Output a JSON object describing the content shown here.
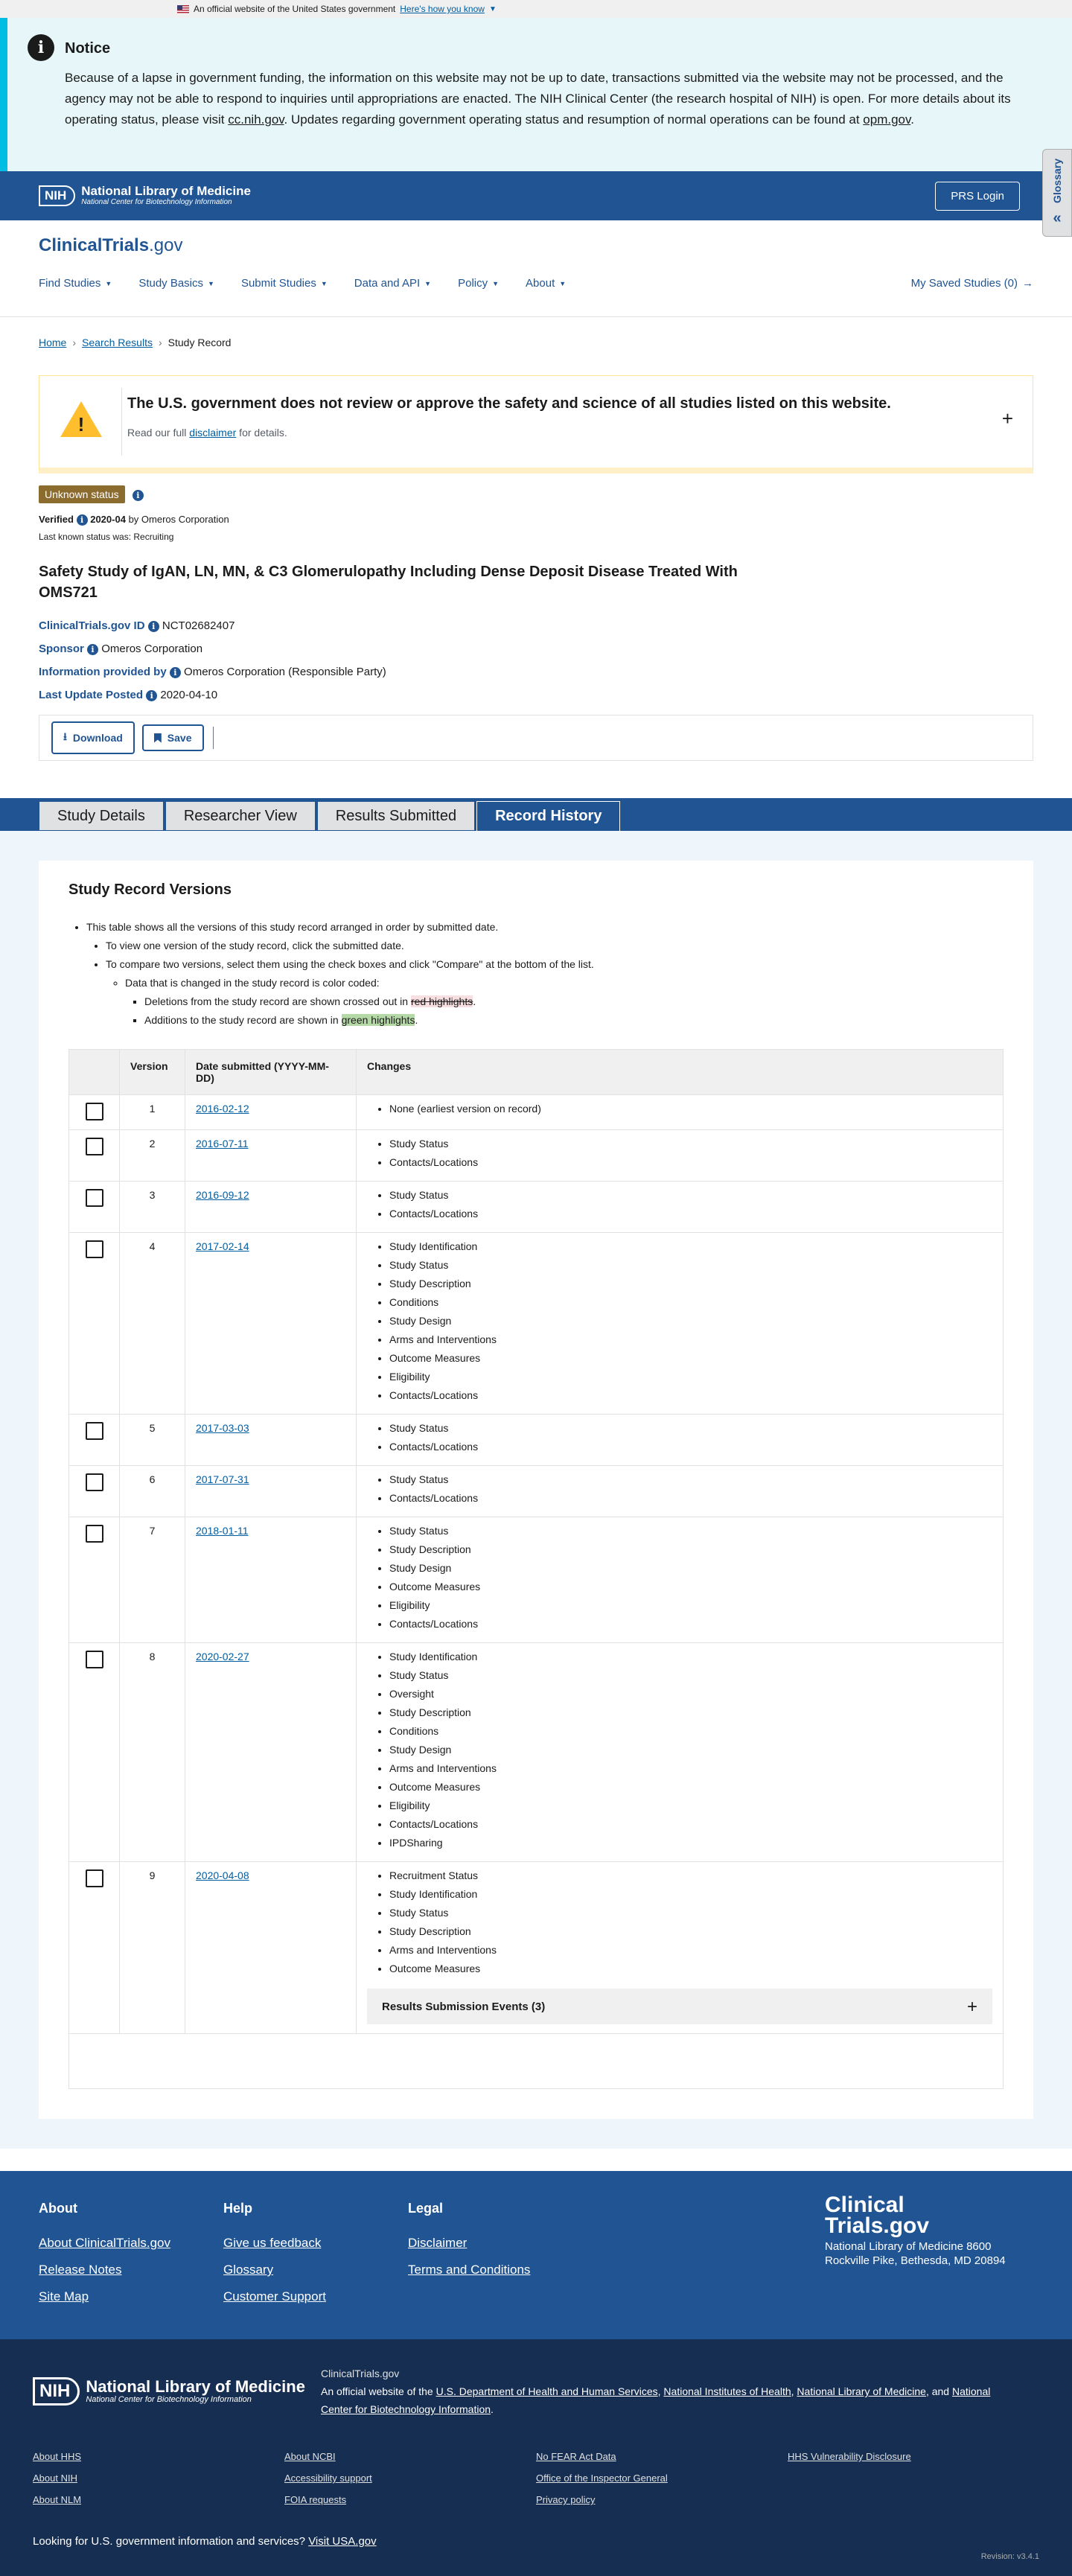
{
  "gov_banner": {
    "text": "An official website of the United States government",
    "link": "Here's how you know"
  },
  "notice": {
    "title": "Notice",
    "body_before_link1": "Because of a lapse in government funding, the information on this website may not be up to date, transactions submitted via the website may not be processed, and the agency may not be able to respond to inquiries until appropriations are enacted. The NIH Clinical Center (the research hospital of NIH) is open. For more details about its operating status, please visit ",
    "link1": "cc.nih.gov",
    "body_between": ". Updates regarding government operating status and resumption of normal operations can be found at ",
    "link2": "opm.gov",
    "body_end": "."
  },
  "nih_header": {
    "logo": "NIH",
    "line1": "National Library of Medicine",
    "line2": "National Center for Biotechnology Information",
    "prs_login": "PRS Login",
    "glossary": "Glossary"
  },
  "site": {
    "logo_main": "ClinicalTrials",
    "logo_suffix": ".gov",
    "nav": [
      "Find Studies",
      "Study Basics",
      "Submit Studies",
      "Data and API",
      "Policy",
      "About"
    ],
    "saved": "My Saved Studies (0)"
  },
  "breadcrumb": [
    "Home",
    "Search Results",
    "Study Record"
  ],
  "disclaimer": {
    "title": "The U.S. government does not review or approve the safety and science of all studies listed on this website.",
    "pre": "Read our full ",
    "link": "disclaimer",
    "post": " for details."
  },
  "status": {
    "badge": "Unknown status",
    "verified_label": "Verified",
    "verified_date": "2020-04",
    "verified_by": "by Omeros Corporation",
    "last_known": "Last known status was: Recruiting"
  },
  "study": {
    "title": "Safety Study of IgAN, LN, MN, & C3 Glomerulopathy Including Dense Deposit Disease Treated With OMS721",
    "id_label": "ClinicalTrials.gov ID",
    "id_value": "NCT02682407",
    "sponsor_label": "Sponsor",
    "sponsor_value": "Omeros Corporation",
    "info_label": "Information provided by",
    "info_value": "Omeros Corporation (Responsible Party)",
    "update_label": "Last Update Posted",
    "update_value": "2020-04-10"
  },
  "actions": {
    "download": "Download",
    "save": "Save"
  },
  "tabs": [
    "Study Details",
    "Researcher View",
    "Results Submitted",
    "Record History"
  ],
  "record": {
    "title": "Study Record Versions",
    "intro1": "This table shows all the versions of this study record arranged in order by submitted date.",
    "intro2": "To view one version of the study record, click the submitted date.",
    "intro3": "To compare two versions, select them using the check boxes and click \"Compare\" at the bottom of the list.",
    "intro4": "Data that is changed in the study record is color coded:",
    "del_pre": "Deletions from the study record are shown crossed out in ",
    "del_hl": "red highlights",
    "add_pre": "Additions to the study record are shown in ",
    "add_hl": "green highlights",
    "headers": {
      "version": "Version",
      "date": "Date submitted (YYYY-MM-DD)",
      "changes": "Changes"
    },
    "events": "Results Submission Events (3)",
    "rows": [
      {
        "version": "1",
        "date": "2016-02-12",
        "changes": [
          "None (earliest version on record)"
        ]
      },
      {
        "version": "2",
        "date": "2016-07-11",
        "changes": [
          "Study Status",
          "Contacts/Locations"
        ]
      },
      {
        "version": "3",
        "date": "2016-09-12",
        "changes": [
          "Study Status",
          "Contacts/Locations"
        ]
      },
      {
        "version": "4",
        "date": "2017-02-14",
        "changes": [
          "Study Identification",
          "Study Status",
          "Study Description",
          "Conditions",
          "Study Design",
          "Arms and Interventions",
          "Outcome Measures",
          "Eligibility",
          "Contacts/Locations"
        ]
      },
      {
        "version": "5",
        "date": "2017-03-03",
        "changes": [
          "Study Status",
          "Contacts/Locations"
        ]
      },
      {
        "version": "6",
        "date": "2017-07-31",
        "changes": [
          "Study Status",
          "Contacts/Locations"
        ]
      },
      {
        "version": "7",
        "date": "2018-01-11",
        "changes": [
          "Study Status",
          "Study Description",
          "Study Design",
          "Outcome Measures",
          "Eligibility",
          "Contacts/Locations"
        ]
      },
      {
        "version": "8",
        "date": "2020-02-27",
        "changes": [
          "Study Identification",
          "Study Status",
          "Oversight",
          "Study Description",
          "Conditions",
          "Study Design",
          "Arms and Interventions",
          "Outcome Measures",
          "Eligibility",
          "Contacts/Locations",
          "IPDSharing"
        ]
      },
      {
        "version": "9",
        "date": "2020-04-08",
        "changes": [
          "Recruitment Status",
          "Study Identification",
          "Study Status",
          "Study Description",
          "Arms and Interventions",
          "Outcome Measures"
        ]
      }
    ]
  },
  "footer": {
    "cols": [
      {
        "title": "About",
        "links": [
          "About ClinicalTrials.gov",
          "Release Notes",
          "Site Map"
        ]
      },
      {
        "title": "Help",
        "links": [
          "Give us feedback",
          "Glossary",
          "Customer Support"
        ]
      },
      {
        "title": "Legal",
        "links": [
          "Disclaimer",
          "Terms and Conditions"
        ]
      }
    ],
    "brand_line1": "Clinical",
    "brand_line2": "Trials.gov",
    "address": "National Library of Medicine 8600 Rockville Pike, Bethesda, MD 20894"
  },
  "footer_bottom": {
    "logo": "NIH",
    "line1": "National Library of Medicine",
    "line2": "National Center for Biotechnology Information",
    "site": "ClinicalTrials.gov",
    "official_pre": "An official website of the ",
    "hhs": "U.S. Department of Health and Human Services",
    "nih": "National Institutes of Health",
    "nlm": "National Library of Medicine",
    "and": "and",
    "ncbi": "National Center for Biotechnology Information",
    "links": [
      [
        "About HHS",
        "About NIH",
        "About NLM"
      ],
      [
        "About NCBI",
        "Accessibility support",
        "FOIA requests"
      ],
      [
        "No FEAR Act Data",
        "Office of the Inspector General",
        "Privacy policy"
      ],
      [
        "HHS Vulnerability Disclosure"
      ]
    ],
    "usa_pre": "Looking for U.S. government information and services?",
    "usa_link": "Visit USA.gov",
    "revision": "Revision: v3.4.1"
  }
}
